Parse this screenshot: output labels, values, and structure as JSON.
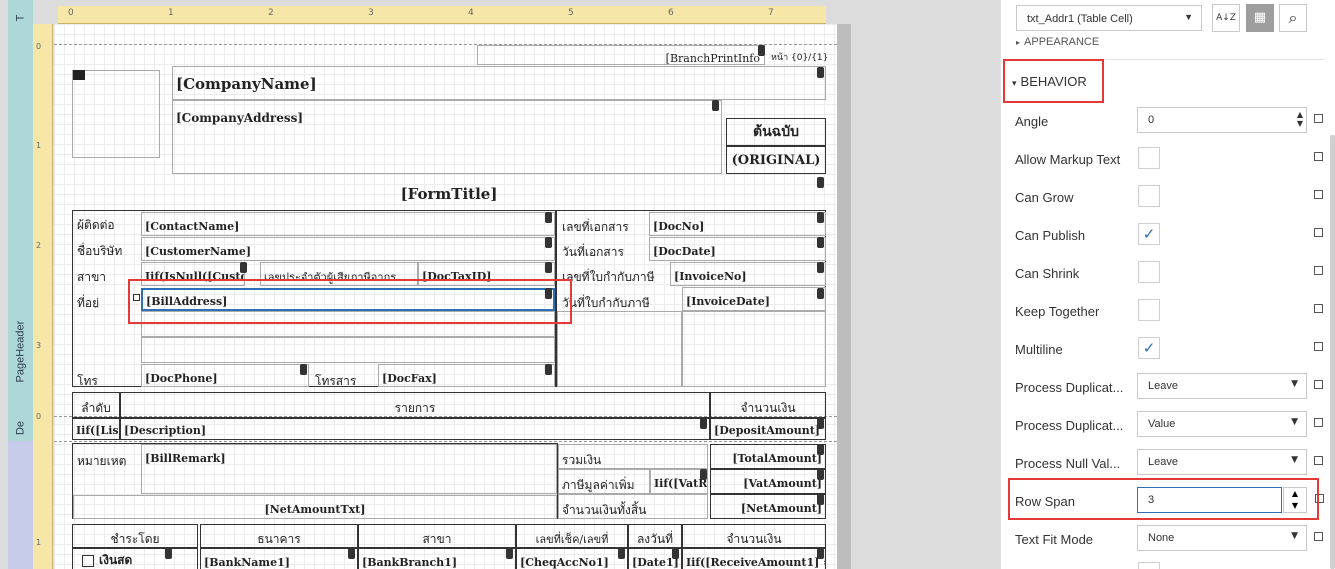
{
  "designer": {
    "ruler_ticks": [
      "0",
      "1",
      "2",
      "3",
      "4",
      "5",
      "6",
      "7"
    ],
    "vruler_ticks": [
      "0",
      "1",
      "2",
      "3",
      "0",
      "1"
    ],
    "bands": {
      "top_label": "T",
      "page_header": "PageHeader",
      "detail": "De"
    },
    "branch_print_info": "[BranchPrintInfo",
    "page_no": "หน้า {0}/{1}",
    "company_name": "[CompanyName]",
    "company_address": "[CompanyAddress]",
    "copy_original_th": "ต้นฉบับ",
    "copy_original_en": "(ORIGINAL)",
    "form_title": "[FormTitle]",
    "contact_label": "ผู้ติดต่อ",
    "contact_name": "[ContactName]",
    "doc_no_label": "เลขที่เอกสาร",
    "doc_no": "[DocNo]",
    "company_label": "ชื่อบริษัท",
    "customer_name": "[CustomerName]",
    "doc_date_label": "วันที่เอกสาร",
    "doc_date": "[DocDate]",
    "branch_label": "สาขา",
    "iif_custom": "Iif(IsNull([Custom",
    "tax_id_label": "เลขประจำตัวผู้เสียภาษีอากร",
    "doc_tax_id": "[DocTaxID]",
    "invoice_no_label": "เลขที่ใบกำกับภาษี",
    "invoice_no": "[InvoiceNo]",
    "address_label": "ที่อยู่",
    "bill_address": "[BillAddress]",
    "invoice_date_label": "วันที่ใบกำกับภาษี",
    "invoice_date": "[InvoiceDate]",
    "phone_label": "โทร",
    "doc_phone": "[DocPhone]",
    "fax_label": "โทรสาร",
    "doc_fax": "[DocFax]",
    "seq_label": "ลำดับ",
    "items_label": "รายการ",
    "amount_label": "จำนวนเงิน",
    "iif_list": "Iif([Lis",
    "description": "[Description]",
    "deposit_amount": "[DepositAmount]",
    "remark_label": "หมายเหตุ",
    "bill_remark": "[BillRemark]",
    "total_label": "รวมเงิน",
    "total_amount": "[TotalAmount]",
    "vat_label": "ภาษีมูลค่าเพิ่ม",
    "iif_vat": "Iif([VatRa",
    "vat_amount": "[VatAmount]",
    "net_amount_txt": "[NetAmountTxt]",
    "net_label": "จำนวนเงินทั้งสิ้น",
    "net_amount": "[NetAmount]",
    "pay_by_label": "ชำระโดย",
    "bank_label": "ธนาคาร",
    "pay_branch_label": "สาขา",
    "cheque_label": "เลขที่เช็ค/เลขที่",
    "date_label": "ลงวันที่",
    "pay_amount_label": "จำนวนเงิน",
    "cash_label": "เงินสด",
    "bank_name1": "[BankName1]",
    "bank_branch1": "[BankBranch1]",
    "cheq_acc_no1": "[CheqAccNo1]",
    "date1": "[Date1]",
    "receive_amount1": "Iif([ReceiveAmount1] =="
  },
  "props": {
    "selector_value": "txt_Addr1 (Table Cell)",
    "sort_icon": "A↓Z",
    "category_icon": "▦",
    "search_icon": "⌕",
    "appearance_label": "APPEARANCE",
    "behavior_label": "BEHAVIOR",
    "rows": [
      {
        "label": "Angle",
        "kind": "spin",
        "value": "0"
      },
      {
        "label": "Allow Markup Text",
        "kind": "check",
        "value": ""
      },
      {
        "label": "Can Grow",
        "kind": "check",
        "value": ""
      },
      {
        "label": "Can Publish",
        "kind": "check",
        "value": "✓"
      },
      {
        "label": "Can Shrink",
        "kind": "check",
        "value": ""
      },
      {
        "label": "Keep Together",
        "kind": "check",
        "value": ""
      },
      {
        "label": "Multiline",
        "kind": "check",
        "value": "✓"
      },
      {
        "label": "Process Duplicat...",
        "kind": "drop",
        "value": "Leave"
      },
      {
        "label": "Process Duplicat...",
        "kind": "drop",
        "value": "Value"
      },
      {
        "label": "Process Null Val...",
        "kind": "drop",
        "value": "Leave"
      },
      {
        "label": "Row Span",
        "kind": "spin",
        "value": "3"
      },
      {
        "label": "Text Fit Mode",
        "kind": "drop",
        "value": "None"
      }
    ]
  },
  "colors": {
    "highlight": "#e53935",
    "ruler": "#f6e7a9",
    "band_header": "#aed7d8",
    "band_detail": "#c5cbe9",
    "selection": "#2f6fb6"
  }
}
